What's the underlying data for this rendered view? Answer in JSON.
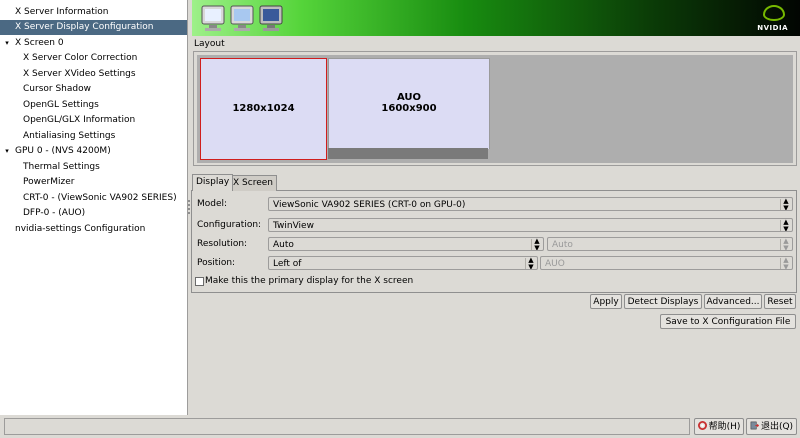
{
  "sidebar": {
    "items": [
      {
        "label": "X Server Information",
        "expander": ""
      },
      {
        "label": "X Server Display Configuration",
        "expander": ""
      },
      {
        "label": "X Screen 0",
        "expander": "▾"
      },
      {
        "label": "X Server Color Correction",
        "expander": ""
      },
      {
        "label": "X Server XVideo Settings",
        "expander": ""
      },
      {
        "label": "Cursor Shadow",
        "expander": ""
      },
      {
        "label": "OpenGL Settings",
        "expander": ""
      },
      {
        "label": "OpenGL/GLX Information",
        "expander": ""
      },
      {
        "label": "Antialiasing Settings",
        "expander": ""
      },
      {
        "label": "GPU 0 - (NVS 4200M)",
        "expander": "▾"
      },
      {
        "label": "Thermal Settings",
        "expander": ""
      },
      {
        "label": "PowerMizer",
        "expander": ""
      },
      {
        "label": "CRT-0 - (ViewSonic VA902 SERIES)",
        "expander": ""
      },
      {
        "label": "DFP-0 - (AUO)",
        "expander": ""
      },
      {
        "label": "nvidia-settings Configuration",
        "expander": ""
      }
    ],
    "selected_index": 1
  },
  "banner": {
    "logo_text": "NVIDIA",
    "colors": {
      "light": "#9ef08a",
      "dark": "#020502",
      "accent": "#76b900"
    }
  },
  "layout": {
    "label": "Layout",
    "displays": [
      {
        "name": "",
        "resolution": "1280x1024"
      },
      {
        "name": "AUO",
        "resolution": "1600x900"
      }
    ]
  },
  "tabs": {
    "display": "Display",
    "xscreen": "X Screen"
  },
  "form": {
    "model_label": "Model:",
    "model_value": "ViewSonic VA902 SERIES (CRT-0 on GPU-0)",
    "configuration_label": "Configuration:",
    "configuration_value": "TwinView",
    "resolution_label": "Resolution:",
    "resolution_value": "Auto",
    "refresh_value": "Auto",
    "position_label": "Position:",
    "position_value": "Left of",
    "position_target": "AUO",
    "primary_label": "Make this the primary display for the X screen"
  },
  "buttons": {
    "apply": "Apply",
    "detect": "Detect Displays",
    "advanced": "Advanced...",
    "reset": "Reset",
    "save": "Save to X Configuration File",
    "help": "帮助(H)",
    "quit": "退出(Q)"
  },
  "icons": {
    "expander": "triangle-down-icon",
    "combo": "spin-arrows-icon",
    "help": "help-lifebuoy-icon",
    "quit": "quit-door-icon"
  }
}
